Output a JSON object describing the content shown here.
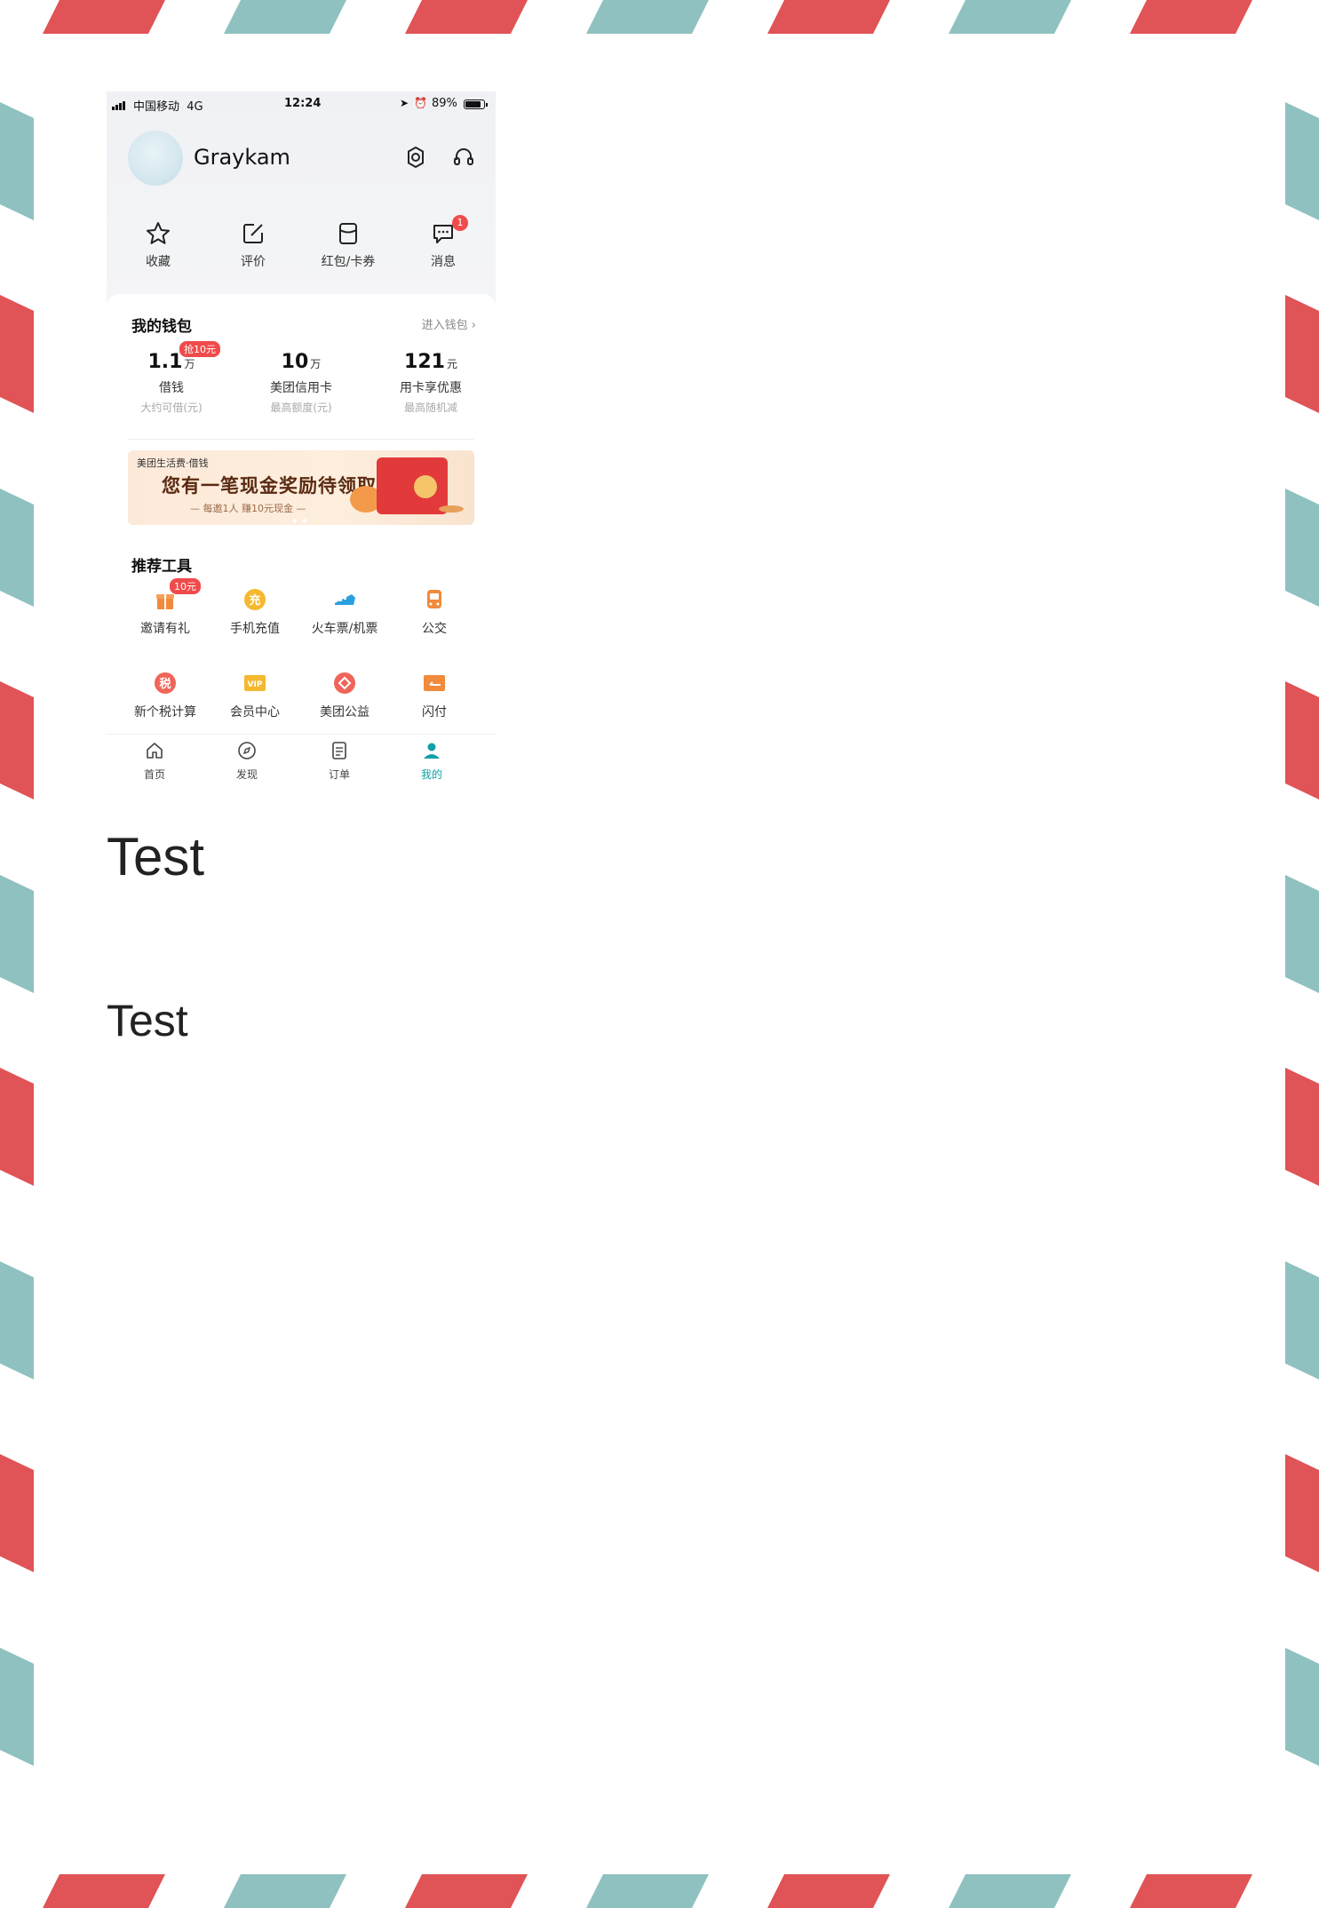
{
  "colors": {
    "stripe_red": "#e05356",
    "stripe_teal": "#8fc1c0",
    "accent_teal": "#11a0a8",
    "badge_red": "#f04b4b"
  },
  "status_bar": {
    "carrier": "中国移动",
    "network": "4G",
    "time": "12:24",
    "battery": "89%",
    "battery_level": 0.89
  },
  "profile": {
    "username": "Graykam",
    "settings_icon": "gear-icon",
    "service_icon": "headset-icon"
  },
  "quick_actions": [
    {
      "label": "收藏",
      "icon": "star-icon"
    },
    {
      "label": "评价",
      "icon": "edit-icon"
    },
    {
      "label": "红包/卡券",
      "icon": "coupon-icon"
    },
    {
      "label": "消息",
      "icon": "message-icon",
      "badge": "1"
    }
  ],
  "wallet": {
    "title": "我的钱包",
    "link": "进入钱包 ›",
    "items": [
      {
        "value": "1.1",
        "unit": "万",
        "name": "借钱",
        "sub": "大约可借(元)",
        "tag": "抢10元"
      },
      {
        "value": "10",
        "unit": "万",
        "name": "美团信用卡",
        "sub": "最高额度(元)"
      },
      {
        "value": "121",
        "unit": "元",
        "name": "用卡享优惠",
        "sub": "最高随机减"
      }
    ]
  },
  "banner": {
    "brand": "美团生活费·借钱",
    "title": "您有一笔现金奖励待领取",
    "subtitle": "— 每邀1人 赚10元现金 —"
  },
  "tools": {
    "title": "推荐工具",
    "items": [
      {
        "label": "邀请有礼",
        "icon": "gift-icon",
        "tag": "10元"
      },
      {
        "label": "手机充值",
        "icon": "recharge-icon",
        "glyph": "充"
      },
      {
        "label": "火车票/机票",
        "icon": "train-icon"
      },
      {
        "label": "公交",
        "icon": "bus-icon"
      },
      {
        "label": "新个税计算",
        "icon": "tax-icon",
        "glyph": "税"
      },
      {
        "label": "会员中心",
        "icon": "vip-icon",
        "glyph": "VIP"
      },
      {
        "label": "美团公益",
        "icon": "charity-icon"
      },
      {
        "label": "闪付",
        "icon": "quickpay-icon"
      }
    ]
  },
  "tabbar": [
    {
      "label": "首页",
      "icon": "home-icon"
    },
    {
      "label": "发现",
      "icon": "compass-icon"
    },
    {
      "label": "订单",
      "icon": "order-icon"
    },
    {
      "label": "我的",
      "icon": "user-icon",
      "active": true
    }
  ],
  "headings": {
    "big": "Test",
    "medium": "Test"
  }
}
